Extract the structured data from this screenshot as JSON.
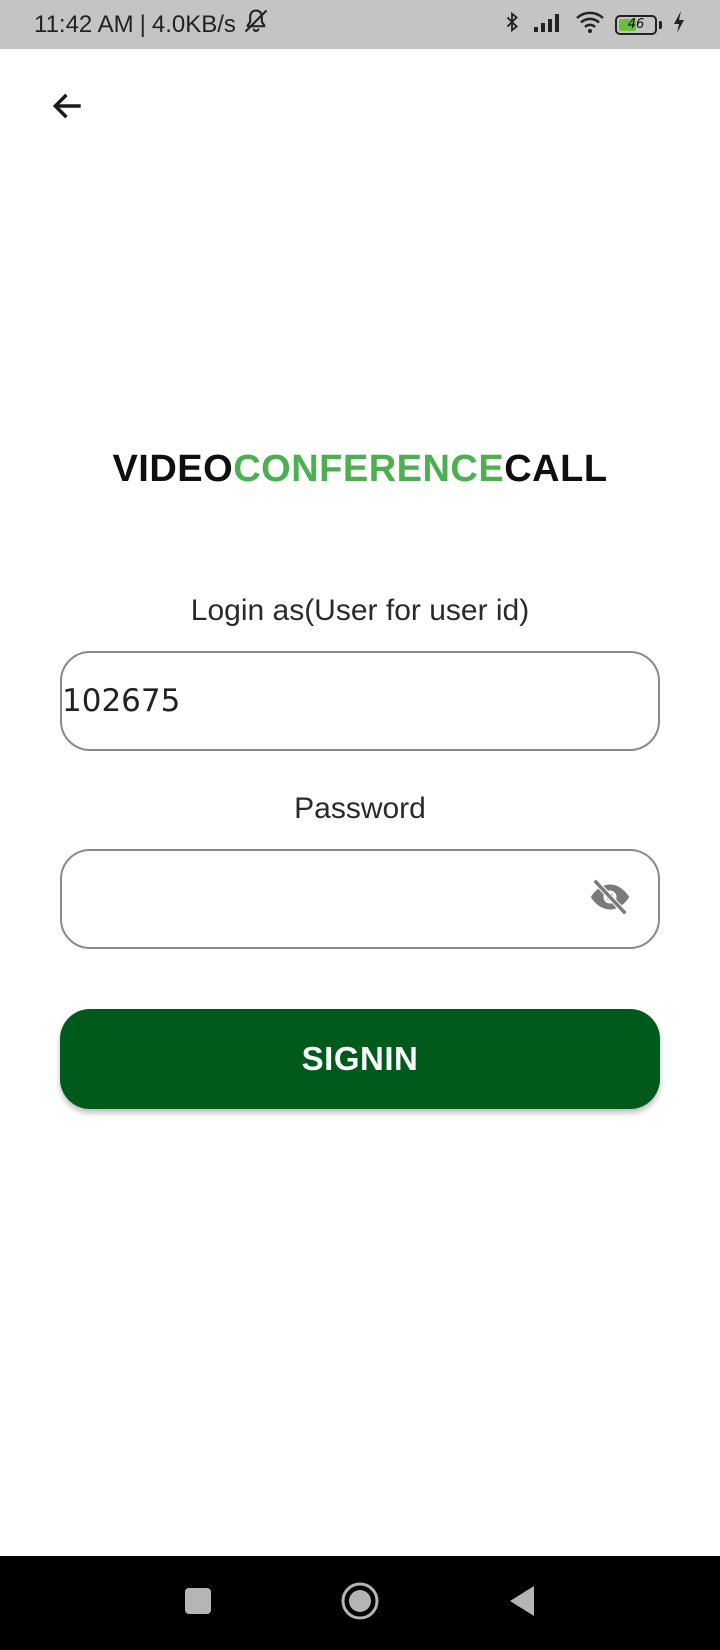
{
  "status_bar": {
    "time": "11:42 AM",
    "separator": "|",
    "network_speed": "4.0KB/s",
    "battery_level": "46",
    "battery_fraction": 0.46
  },
  "title": {
    "part1": "VIDEO",
    "part2": "CONFERENCE",
    "part3": "CALL"
  },
  "login": {
    "label": "Login as(User for user id)",
    "value": "102675"
  },
  "password": {
    "label": "Password",
    "value": ""
  },
  "signin": {
    "label": "SIGNIN"
  },
  "colors": {
    "status_bar_bg": "#c4c4c4",
    "title_dark": "#0f0f0f",
    "title_green": "#4caf50",
    "button_bg": "#005a1b",
    "input_border": "#8a8a8a",
    "nav_bar_bg": "#000000"
  },
  "icons": {
    "back": "arrow-left-icon",
    "password_toggle": "eye-off-icon",
    "nav_recents": "square-icon",
    "nav_home": "circle-icon",
    "nav_back": "triangle-back-icon"
  }
}
